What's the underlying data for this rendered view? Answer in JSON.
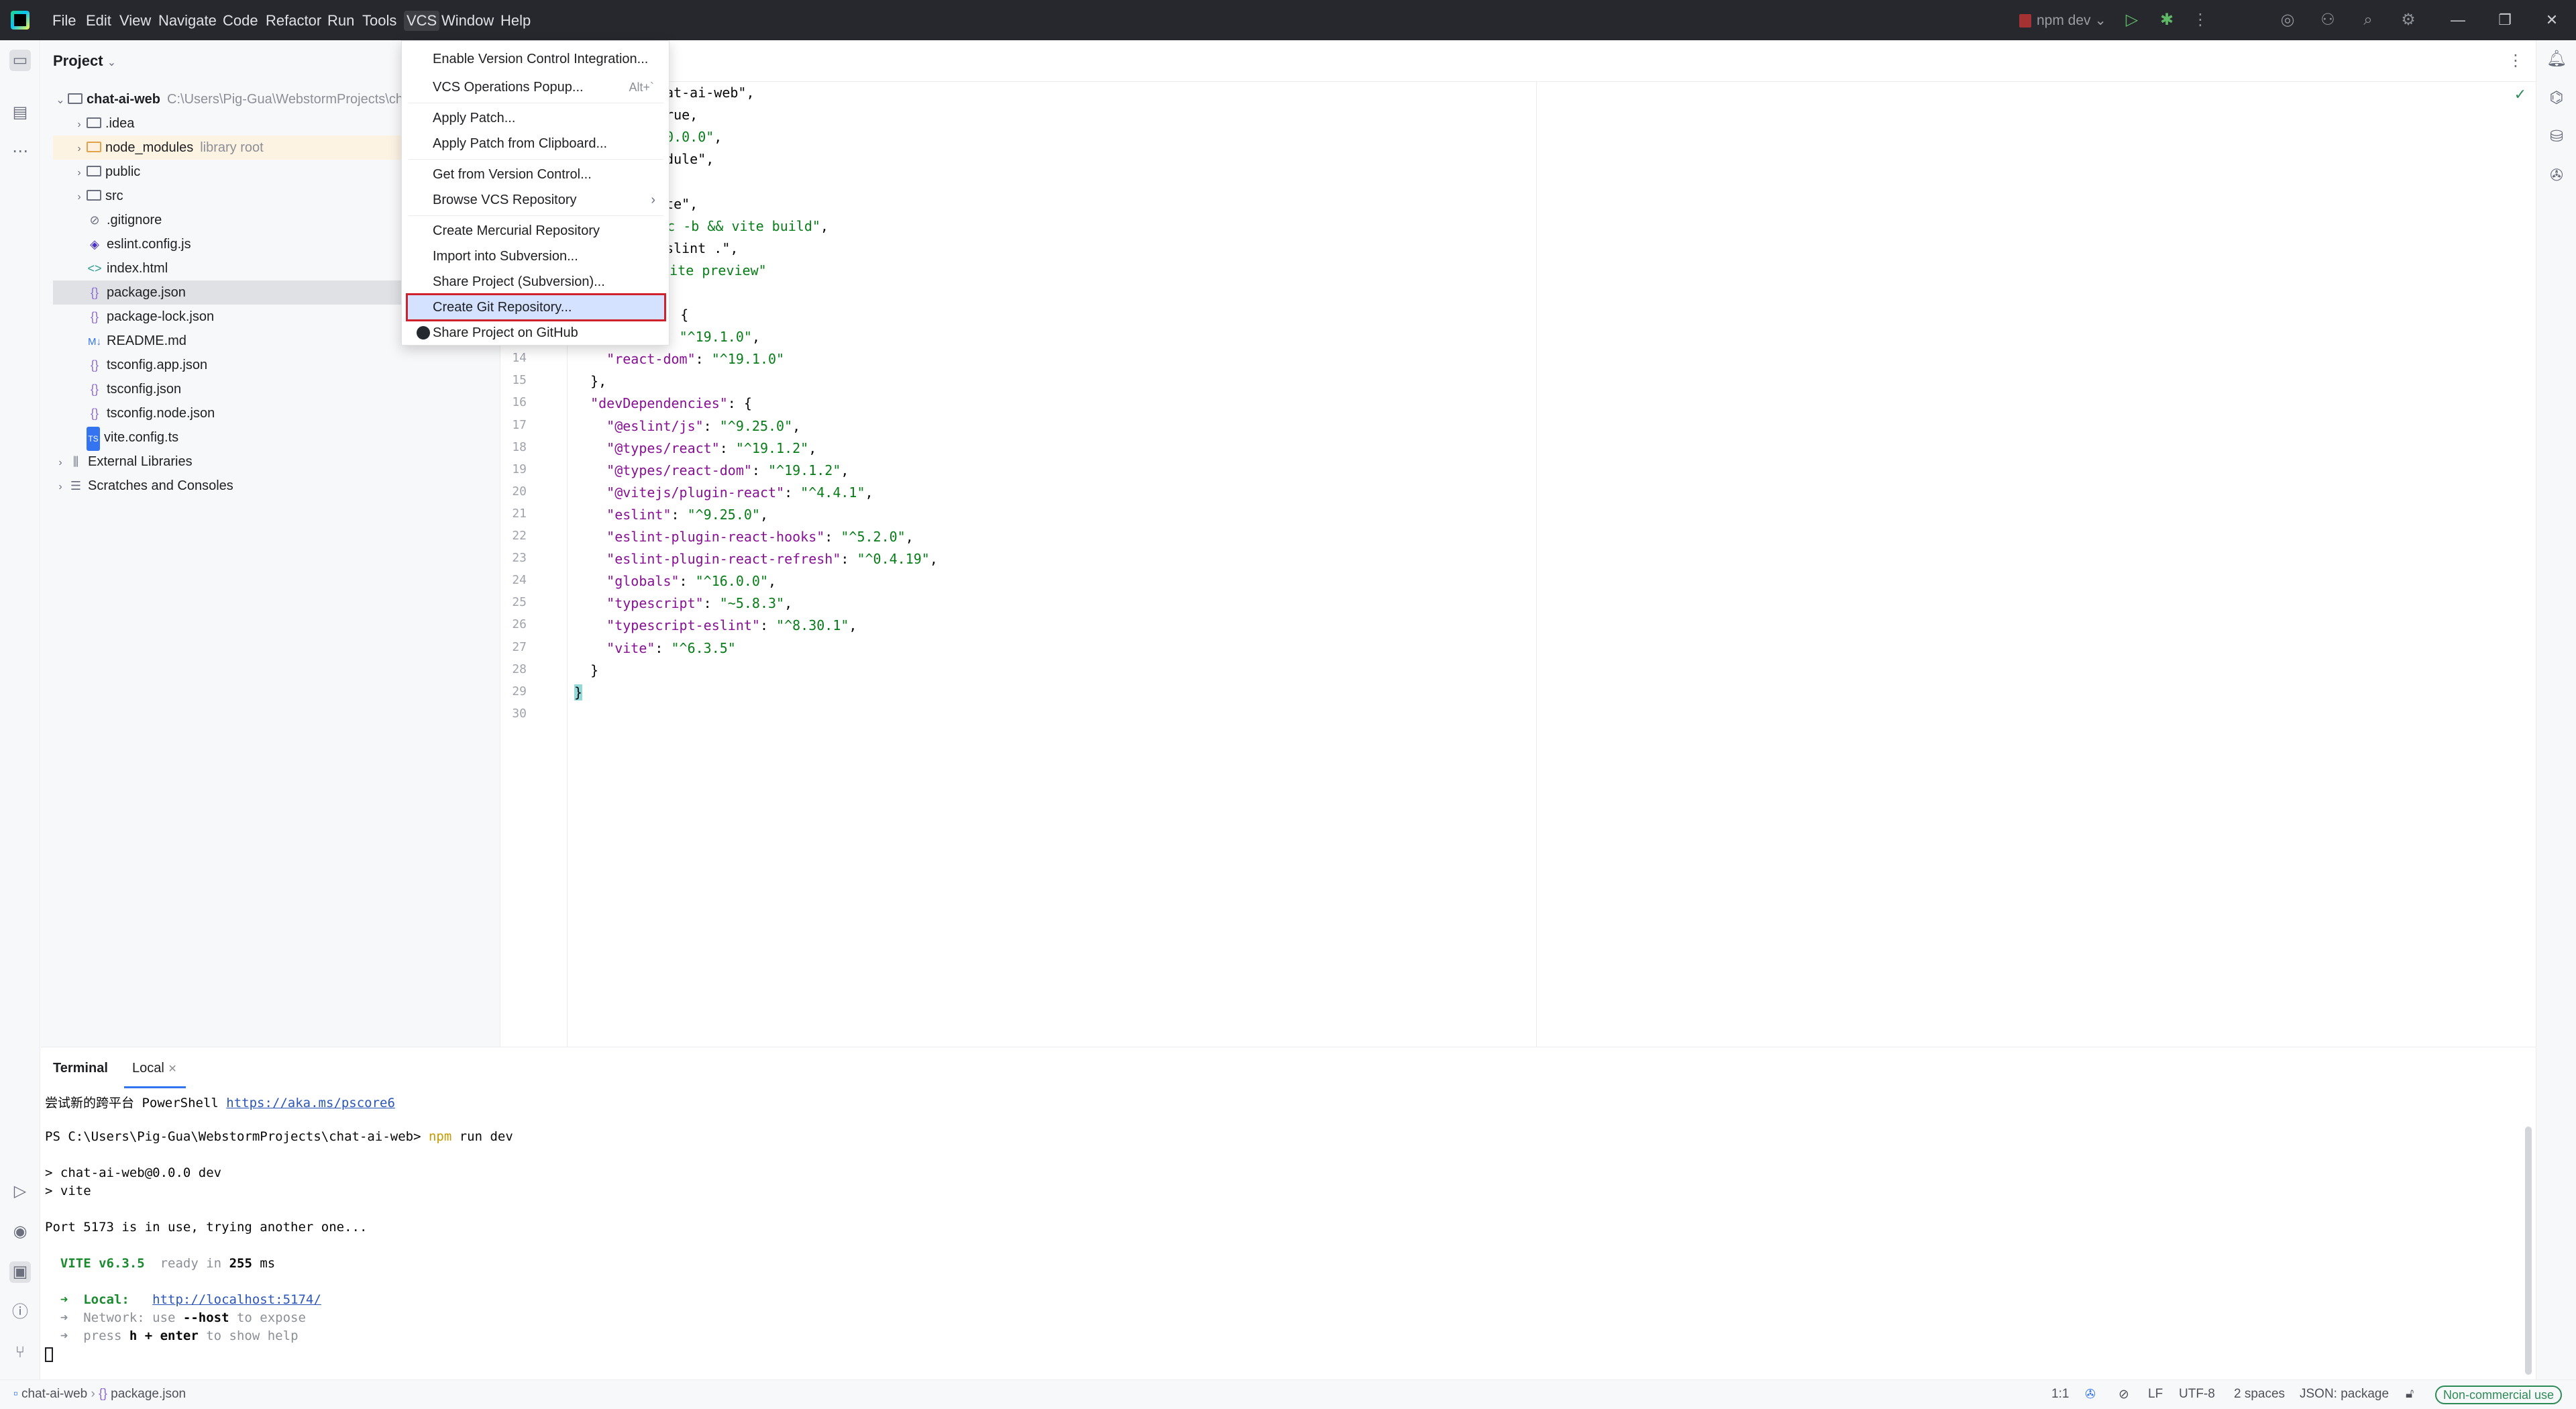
{
  "titlebar": {
    "menu": [
      "File",
      "Edit",
      "View",
      "Navigate",
      "Code",
      "Refactor",
      "Run",
      "Tools",
      "VCS",
      "Window",
      "Help"
    ],
    "run_config": "npm dev"
  },
  "project": {
    "title": "Project",
    "root_name": "chat-ai-web",
    "root_path": "C:\\Users\\Pig-Gua\\WebstormProjects\\ch",
    "items": [
      {
        "label": ".idea",
        "hint": ""
      },
      {
        "label": "node_modules",
        "hint": "library root"
      },
      {
        "label": "public",
        "hint": ""
      },
      {
        "label": "src",
        "hint": ""
      },
      {
        "label": ".gitignore",
        "hint": ""
      },
      {
        "label": "eslint.config.js",
        "hint": ""
      },
      {
        "label": "index.html",
        "hint": ""
      },
      {
        "label": "package.json",
        "hint": ""
      },
      {
        "label": "package-lock.json",
        "hint": ""
      },
      {
        "label": "README.md",
        "hint": ""
      },
      {
        "label": "tsconfig.app.json",
        "hint": ""
      },
      {
        "label": "tsconfig.json",
        "hint": ""
      },
      {
        "label": "tsconfig.node.json",
        "hint": ""
      },
      {
        "label": "vite.config.ts",
        "hint": ""
      }
    ],
    "external_libraries": "External Libraries",
    "scratches": "Scratches and Consoles"
  },
  "vcs_menu": {
    "items": [
      {
        "label": "Enable Version Control Integration...",
        "shortcut": ""
      },
      {
        "label": "VCS Operations Popup...",
        "shortcut": "Alt+`"
      },
      {
        "label": "Apply Patch...",
        "shortcut": ""
      },
      {
        "label": "Apply Patch from Clipboard...",
        "shortcut": ""
      },
      {
        "label": "Get from Version Control...",
        "shortcut": ""
      },
      {
        "label": "Browse VCS Repository",
        "shortcut": ""
      },
      {
        "label": "Create Mercurial Repository",
        "shortcut": ""
      },
      {
        "label": "Import into Subversion...",
        "shortcut": ""
      },
      {
        "label": "Share Project (Subversion)...",
        "shortcut": ""
      },
      {
        "label": "Create Git Repository...",
        "shortcut": ""
      },
      {
        "label": "Share Project on GitHub",
        "shortcut": ""
      }
    ]
  },
  "editor": {
    "lines": [
      {
        "n": "",
        "text": "hat-ai-web\","
      },
      {
        "n": "",
        "text": "true,"
      },
      {
        "n": "",
        "text": "\"0.0.0\","
      },
      {
        "n": "",
        "text": "odule\","
      },
      {
        "n": "",
        "text": "{"
      },
      {
        "n": "",
        "text": "ite\","
      },
      {
        "n": "",
        "text": "\"tsc -b && vite build\","
      },
      {
        "n": "",
        "text": "eslint .\","
      },
      {
        "n": "",
        "text": ": \"vite preview\""
      },
      {
        "n": "",
        "text": ""
      },
      {
        "n": "",
        "text": "ies\": {"
      },
      {
        "n": "13",
        "text": "    \"react\": \"^19.1.0\","
      },
      {
        "n": "14",
        "text": "    \"react-dom\": \"^19.1.0\""
      },
      {
        "n": "15",
        "text": "  },"
      },
      {
        "n": "16",
        "text": "  \"devDependencies\": {"
      },
      {
        "n": "17",
        "text": "    \"@eslint/js\": \"^9.25.0\","
      },
      {
        "n": "18",
        "text": "    \"@types/react\": \"^19.1.2\","
      },
      {
        "n": "19",
        "text": "    \"@types/react-dom\": \"^19.1.2\","
      },
      {
        "n": "20",
        "text": "    \"@vitejs/plugin-react\": \"^4.4.1\","
      },
      {
        "n": "21",
        "text": "    \"eslint\": \"^9.25.0\","
      },
      {
        "n": "22",
        "text": "    \"eslint-plugin-react-hooks\": \"^5.2.0\","
      },
      {
        "n": "23",
        "text": "    \"eslint-plugin-react-refresh\": \"^0.4.19\","
      },
      {
        "n": "24",
        "text": "    \"globals\": \"^16.0.0\","
      },
      {
        "n": "25",
        "text": "    \"typescript\": \"~5.8.3\","
      },
      {
        "n": "26",
        "text": "    \"typescript-eslint\": \"^8.30.1\","
      },
      {
        "n": "27",
        "text": "    \"vite\": \"^6.3.5\""
      },
      {
        "n": "28",
        "text": "  }"
      },
      {
        "n": "29",
        "text": "}"
      },
      {
        "n": "30",
        "text": ""
      }
    ]
  },
  "terminal": {
    "title": "Terminal",
    "tab": "Local",
    "lines": [
      {
        "text": "尝试新的跨平台 PowerShell ",
        "link": "https://aka.ms/pscore6"
      },
      {
        "text": ""
      },
      {
        "prompt": "PS C:\\Users\\Pig-Gua\\WebstormProjects\\chat-ai-web> ",
        "cmd": "npm",
        "rest": " run dev"
      },
      {
        "text": ""
      },
      {
        "text": "> chat-ai-web@0.0.0 dev"
      },
      {
        "text": "> vite"
      },
      {
        "text": ""
      },
      {
        "text": "Port 5173 is in use, trying another one..."
      },
      {
        "text": ""
      },
      {
        "vite": "  VITE v6.3.5",
        "ready": "  ready in ",
        "ms": "255",
        "unit": " ms"
      },
      {
        "text": ""
      },
      {
        "local_label": "  ➜  Local:   ",
        "local_url": "http://localhost:5174/"
      },
      {
        "network": "  ➜  Network: use ",
        "host": "--host",
        "expose": " to expose"
      },
      {
        "help1": "  ➜  press ",
        "help2": "h + enter",
        "help3": " to show help"
      }
    ]
  },
  "statusbar": {
    "breadcrumb_root": "chat-ai-web",
    "breadcrumb_file": "package.json",
    "position": "1:1",
    "line_ending": "LF",
    "encoding": "UTF-8",
    "indent": "2 spaces",
    "schema": "JSON: package",
    "license": "Non-commercial use"
  }
}
